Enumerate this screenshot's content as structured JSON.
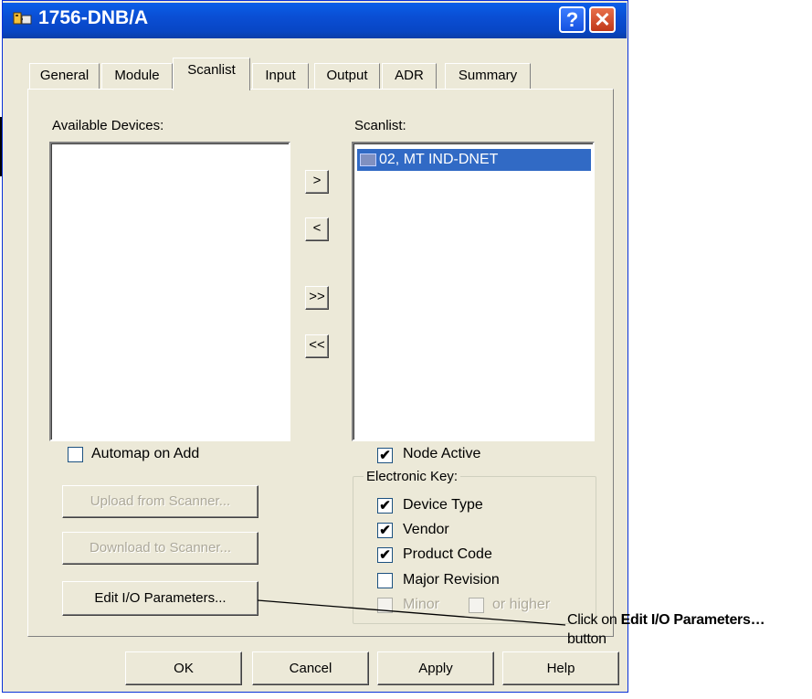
{
  "window": {
    "title": "1756-DNB/A",
    "help_glyph": "?",
    "close_glyph": "✕"
  },
  "tabs": [
    {
      "label": "General",
      "active": false
    },
    {
      "label": "Module",
      "active": false
    },
    {
      "label": "Scanlist",
      "active": true
    },
    {
      "label": "Input",
      "active": false
    },
    {
      "label": "Output",
      "active": false
    },
    {
      "label": "ADR",
      "active": false
    },
    {
      "label": "Summary",
      "active": false
    }
  ],
  "available": {
    "label": "Available Devices:",
    "items": []
  },
  "scanlist": {
    "label": "Scanlist:",
    "items": [
      {
        "text": "02, MT IND-DNET",
        "selected": true
      }
    ]
  },
  "move_buttons": {
    "add": ">",
    "remove": "<",
    "add_all": ">>",
    "remove_all": "<<"
  },
  "left_options": {
    "automap": {
      "label": "Automap on Add",
      "checked": false
    },
    "upload_label": "Upload from Scanner...",
    "download_label": "Download to Scanner...",
    "edit_io_label": "Edit I/O Parameters..."
  },
  "right_options": {
    "node_active": {
      "label": "Node Active",
      "checked": true
    },
    "electronic_key": {
      "legend": "Electronic Key:",
      "device_type": {
        "label": "Device Type",
        "checked": true
      },
      "vendor": {
        "label": "Vendor",
        "checked": true
      },
      "product_code": {
        "label": "Product Code",
        "checked": true
      },
      "major_revision": {
        "label": "Major Revision",
        "checked": false
      },
      "minor": {
        "label": "Minor",
        "checked": false,
        "enabled": false
      },
      "or_higher": {
        "label": "or higher",
        "checked": false,
        "enabled": false
      }
    }
  },
  "footer": {
    "ok": "OK",
    "cancel": "Cancel",
    "apply": "Apply",
    "help": "Help"
  },
  "annotation": {
    "prefix": "Click on ",
    "bold": "Edit I/O Parameters…",
    "suffix": "button"
  },
  "colors": {
    "title_bar": "#0a4ed4",
    "selection": "#316ac5",
    "dialog_face": "#ece9d8"
  }
}
